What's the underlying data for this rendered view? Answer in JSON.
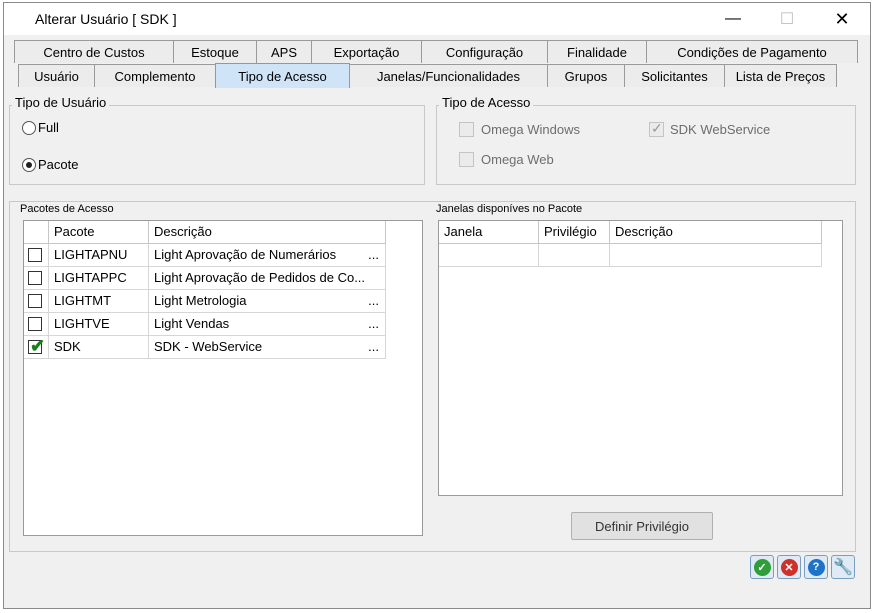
{
  "window": {
    "title": "Alterar Usuário [ SDK ]"
  },
  "tabs_row1": [
    "Centro de Custos",
    "Estoque",
    "APS",
    "Exportação",
    "Configuração",
    "Finalidade",
    "Condições de Pagamento"
  ],
  "tabs_row2": [
    "Usuário",
    "Complemento",
    "Tipo de Acesso",
    "Janelas/Funcionalidades",
    "Grupos",
    "Solicitantes",
    "Lista de Preços"
  ],
  "active_tab": "Tipo de Acesso",
  "tipo_usuario": {
    "title": "Tipo de Usuário",
    "options": [
      {
        "label": "Full",
        "selected": false
      },
      {
        "label": "Pacote",
        "selected": true
      }
    ]
  },
  "tipo_acesso": {
    "title": "Tipo de Acesso",
    "options": [
      {
        "label": "Omega Windows",
        "checked": false
      },
      {
        "label": "SDK WebService",
        "checked": true
      },
      {
        "label": "Omega Web",
        "checked": false
      }
    ]
  },
  "pacotes": {
    "title": "Pacotes de Acesso",
    "columns": [
      "Pacote",
      "Descrição"
    ],
    "rows": [
      {
        "checked": false,
        "pacote": "LIGHTAPNU",
        "descricao": "Light Aprovação de Numerários",
        "more": "..."
      },
      {
        "checked": false,
        "pacote": "LIGHTAPPC",
        "descricao": "Light Aprovação de Pedidos de Co...",
        "more": ""
      },
      {
        "checked": false,
        "pacote": "LIGHTMT",
        "descricao": "Light Metrologia",
        "more": "..."
      },
      {
        "checked": false,
        "pacote": "LIGHTVE",
        "descricao": "Light Vendas",
        "more": "..."
      },
      {
        "checked": true,
        "pacote": "SDK",
        "descricao": "SDK - WebService",
        "more": "..."
      }
    ]
  },
  "janelas": {
    "title": "Janelas disponíves no Pacote",
    "columns": [
      "Janela",
      "Privilégio",
      "Descrição"
    ]
  },
  "buttons": {
    "definir_privilegio": "Definir Privilégio"
  },
  "colors": {
    "accent": "#cfe4f7",
    "ok": "#2e9e3a",
    "cancel": "#d0302a",
    "help": "#1e73c8",
    "tool": "#e08a1a"
  }
}
